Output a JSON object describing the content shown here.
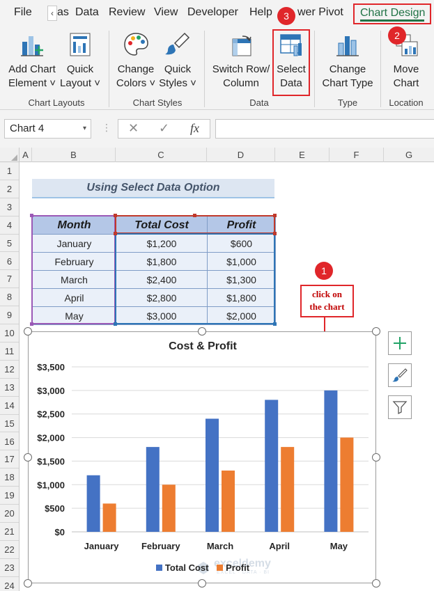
{
  "tabs": {
    "file": "File",
    "formulas_fragment": "as",
    "data": "Data",
    "review": "Review",
    "view": "View",
    "developer": "Developer",
    "help": "Help",
    "power_pivot_fragment": "wer Pivot",
    "chart_design": "Chart Design",
    "scroll_glyph": "‹"
  },
  "ribbon": {
    "add_chart_element": [
      "Add Chart",
      "Element ˅"
    ],
    "quick_layout": [
      "Quick",
      "Layout ˅"
    ],
    "change_colors": [
      "Change",
      "Colors ˅"
    ],
    "quick_styles": [
      "Quick",
      "Styles ˅"
    ],
    "switch_row_column": [
      "Switch Row/",
      "Column"
    ],
    "select_data": [
      "Select",
      "Data"
    ],
    "change_chart_type": [
      "Change",
      "Chart Type"
    ],
    "move_chart": [
      "Move",
      "Chart"
    ],
    "groups": {
      "chart_layouts": "Chart Layouts",
      "chart_styles": "Chart Styles",
      "data": "Data",
      "type": "Type",
      "location": "Location"
    }
  },
  "badges": {
    "one": "1",
    "two": "2",
    "three": "3"
  },
  "formula_bar": {
    "name_box": "Chart 4",
    "name_caret": "▾",
    "grip": "⋮",
    "cancel_glyph": "✕",
    "enter_glyph": "✓",
    "fx_glyph": "fx",
    "formula": ""
  },
  "columns": [
    "A",
    "B",
    "C",
    "D",
    "E",
    "F",
    "G"
  ],
  "rows": [
    "1",
    "2",
    "3",
    "4",
    "5",
    "6",
    "7",
    "8",
    "9",
    "10",
    "11",
    "12",
    "13",
    "14",
    "15",
    "16",
    "17",
    "18",
    "19",
    "20",
    "21",
    "22",
    "23",
    "24"
  ],
  "sheet": {
    "subtitle": "Using Select Data Option",
    "table_headers": [
      "Month",
      "Total Cost",
      "Profit"
    ],
    "table_rows": [
      [
        "January",
        "$1,200",
        "$600"
      ],
      [
        "February",
        "$1,800",
        "$1,000"
      ],
      [
        "March",
        "$2,400",
        "$1,300"
      ],
      [
        "April",
        "$2,800",
        "$1,800"
      ],
      [
        "May",
        "$3,000",
        "$2,000"
      ]
    ]
  },
  "callout": {
    "line1": "click on",
    "line2": "the chart"
  },
  "watermark": {
    "brand": "exceldemy",
    "tagline": "EXCEL · DATA · BI"
  },
  "colors": {
    "accent_red": "#e0262a",
    "excel_green": "#217346",
    "series_total": "#4472c4",
    "series_profit": "#ed7d31"
  },
  "side_buttons": {
    "add": "plus-icon",
    "style": "brush-icon",
    "filter": "filter-icon"
  },
  "chart_data": {
    "type": "bar",
    "title": "Cost & Profit",
    "categories": [
      "January",
      "February",
      "March",
      "April",
      "May"
    ],
    "series": [
      {
        "name": "Total Cost",
        "values": [
          1200,
          1800,
          2400,
          2800,
          3000
        ],
        "color": "#4472c4"
      },
      {
        "name": "Profit",
        "values": [
          600,
          1000,
          1300,
          1800,
          2000
        ],
        "color": "#ed7d31"
      }
    ],
    "yticks": [
      "$0",
      "$500",
      "$1,000",
      "$1,500",
      "$2,000",
      "$2,500",
      "$3,000",
      "$3,500"
    ],
    "ylim": [
      0,
      3500
    ],
    "grid": true,
    "legend": "bottom"
  }
}
